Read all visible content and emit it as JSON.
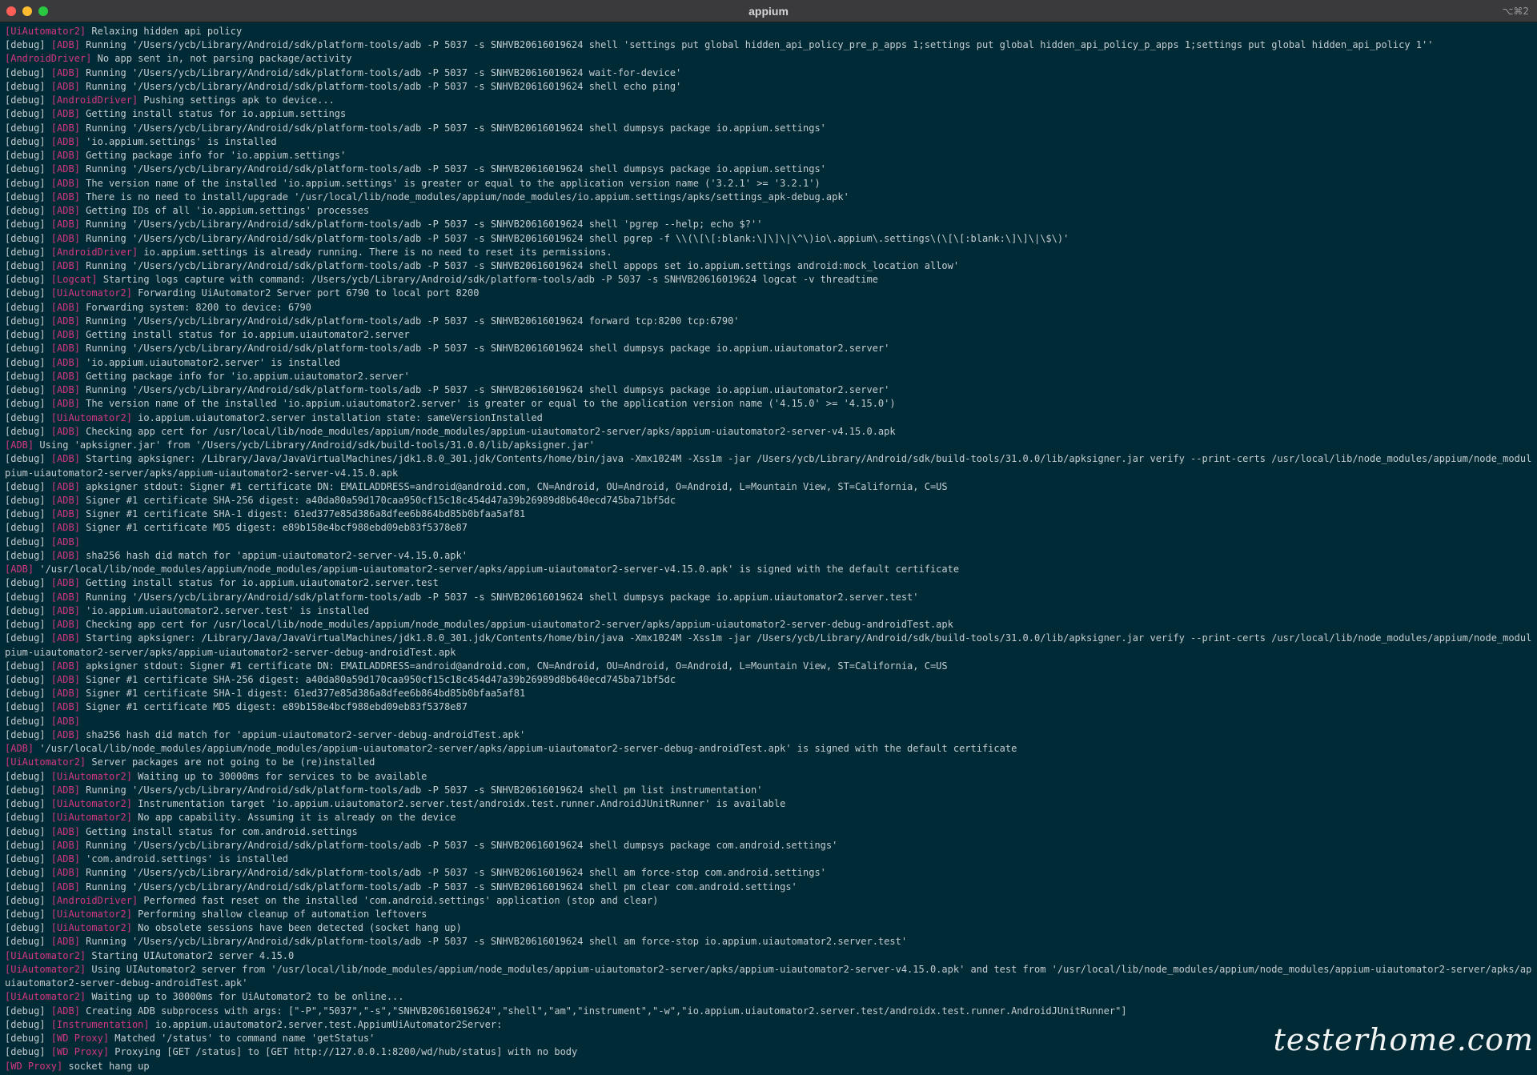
{
  "window": {
    "title": "appium",
    "shortcut": "⌥⌘2",
    "traffic_lights": [
      "close",
      "minimize",
      "zoom"
    ]
  },
  "colors": {
    "background": "#002b36",
    "titlebar": "#3a3a3c",
    "text": "#c5ccd0",
    "tag": "#d33682"
  },
  "watermark": "testerhome.com",
  "log_lines": [
    {
      "level": "",
      "tag": "[UiAutomator2]",
      "text": " Relaxing hidden api policy"
    },
    {
      "level": "[debug] ",
      "tag": "[ADB]",
      "text": " Running '/Users/ycb/Library/Android/sdk/platform-tools/adb -P 5037 -s SNHVB20616019624 shell 'settings put global hidden_api_policy_pre_p_apps 1;settings put global hidden_api_policy_p_apps 1;settings put global hidden_api_policy 1''"
    },
    {
      "level": "",
      "tag": "[AndroidDriver]",
      "text": " No app sent in, not parsing package/activity"
    },
    {
      "level": "[debug] ",
      "tag": "[ADB]",
      "text": " Running '/Users/ycb/Library/Android/sdk/platform-tools/adb -P 5037 -s SNHVB20616019624 wait-for-device'"
    },
    {
      "level": "[debug] ",
      "tag": "[ADB]",
      "text": " Running '/Users/ycb/Library/Android/sdk/platform-tools/adb -P 5037 -s SNHVB20616019624 shell echo ping'"
    },
    {
      "level": "[debug] ",
      "tag": "[AndroidDriver]",
      "text": " Pushing settings apk to device..."
    },
    {
      "level": "[debug] ",
      "tag": "[ADB]",
      "text": " Getting install status for io.appium.settings"
    },
    {
      "level": "[debug] ",
      "tag": "[ADB]",
      "text": " Running '/Users/ycb/Library/Android/sdk/platform-tools/adb -P 5037 -s SNHVB20616019624 shell dumpsys package io.appium.settings'"
    },
    {
      "level": "[debug] ",
      "tag": "[ADB]",
      "text": " 'io.appium.settings' is installed"
    },
    {
      "level": "[debug] ",
      "tag": "[ADB]",
      "text": " Getting package info for 'io.appium.settings'"
    },
    {
      "level": "[debug] ",
      "tag": "[ADB]",
      "text": " Running '/Users/ycb/Library/Android/sdk/platform-tools/adb -P 5037 -s SNHVB20616019624 shell dumpsys package io.appium.settings'"
    },
    {
      "level": "[debug] ",
      "tag": "[ADB]",
      "text": " The version name of the installed 'io.appium.settings' is greater or equal to the application version name ('3.2.1' >= '3.2.1')"
    },
    {
      "level": "[debug] ",
      "tag": "[ADB]",
      "text": " There is no need to install/upgrade '/usr/local/lib/node_modules/appium/node_modules/io.appium.settings/apks/settings_apk-debug.apk'"
    },
    {
      "level": "[debug] ",
      "tag": "[ADB]",
      "text": " Getting IDs of all 'io.appium.settings' processes"
    },
    {
      "level": "[debug] ",
      "tag": "[ADB]",
      "text": " Running '/Users/ycb/Library/Android/sdk/platform-tools/adb -P 5037 -s SNHVB20616019624 shell 'pgrep --help; echo $?''"
    },
    {
      "level": "[debug] ",
      "tag": "[ADB]",
      "text": " Running '/Users/ycb/Library/Android/sdk/platform-tools/adb -P 5037 -s SNHVB20616019624 shell pgrep -f \\\\(\\[\\[:blank:\\]\\]\\|\\^\\)io\\.appium\\.settings\\(\\[\\[:blank:\\]\\]\\|\\$\\)'"
    },
    {
      "level": "[debug] ",
      "tag": "[AndroidDriver]",
      "text": " io.appium.settings is already running. There is no need to reset its permissions."
    },
    {
      "level": "[debug] ",
      "tag": "[ADB]",
      "text": " Running '/Users/ycb/Library/Android/sdk/platform-tools/adb -P 5037 -s SNHVB20616019624 shell appops set io.appium.settings android:mock_location allow'"
    },
    {
      "level": "[debug] ",
      "tag": "[Logcat]",
      "text": " Starting logs capture with command: /Users/ycb/Library/Android/sdk/platform-tools/adb -P 5037 -s SNHVB20616019624 logcat -v threadtime"
    },
    {
      "level": "[debug] ",
      "tag": "[UiAutomator2]",
      "text": " Forwarding UiAutomator2 Server port 6790 to local port 8200"
    },
    {
      "level": "[debug] ",
      "tag": "[ADB]",
      "text": " Forwarding system: 8200 to device: 6790"
    },
    {
      "level": "[debug] ",
      "tag": "[ADB]",
      "text": " Running '/Users/ycb/Library/Android/sdk/platform-tools/adb -P 5037 -s SNHVB20616019624 forward tcp:8200 tcp:6790'"
    },
    {
      "level": "[debug] ",
      "tag": "[ADB]",
      "text": " Getting install status for io.appium.uiautomator2.server"
    },
    {
      "level": "[debug] ",
      "tag": "[ADB]",
      "text": " Running '/Users/ycb/Library/Android/sdk/platform-tools/adb -P 5037 -s SNHVB20616019624 shell dumpsys package io.appium.uiautomator2.server'"
    },
    {
      "level": "[debug] ",
      "tag": "[ADB]",
      "text": " 'io.appium.uiautomator2.server' is installed"
    },
    {
      "level": "[debug] ",
      "tag": "[ADB]",
      "text": " Getting package info for 'io.appium.uiautomator2.server'"
    },
    {
      "level": "[debug] ",
      "tag": "[ADB]",
      "text": " Running '/Users/ycb/Library/Android/sdk/platform-tools/adb -P 5037 -s SNHVB20616019624 shell dumpsys package io.appium.uiautomator2.server'"
    },
    {
      "level": "[debug] ",
      "tag": "[ADB]",
      "text": " The version name of the installed 'io.appium.uiautomator2.server' is greater or equal to the application version name ('4.15.0' >= '4.15.0')"
    },
    {
      "level": "[debug] ",
      "tag": "[UiAutomator2]",
      "text": " io.appium.uiautomator2.server installation state: sameVersionInstalled"
    },
    {
      "level": "[debug] ",
      "tag": "[ADB]",
      "text": " Checking app cert for /usr/local/lib/node_modules/appium/node_modules/appium-uiautomator2-server/apks/appium-uiautomator2-server-v4.15.0.apk"
    },
    {
      "level": "",
      "tag": "[ADB]",
      "text": " Using 'apksigner.jar' from '/Users/ycb/Library/Android/sdk/build-tools/31.0.0/lib/apksigner.jar'"
    },
    {
      "level": "[debug] ",
      "tag": "[ADB]",
      "text": " Starting apksigner: /Library/Java/JavaVirtualMachines/jdk1.8.0_301.jdk/Contents/home/bin/java -Xmx1024M -Xss1m -jar /Users/ycb/Library/Android/sdk/build-tools/31.0.0/lib/apksigner.jar verify --print-certs /usr/local/lib/node_modules/appium/node_modules/ap"
    },
    {
      "level": "",
      "tag": "",
      "text": "pium-uiautomator2-server/apks/appium-uiautomator2-server-v4.15.0.apk"
    },
    {
      "level": "[debug] ",
      "tag": "[ADB]",
      "text": " apksigner stdout: Signer #1 certificate DN: EMAILADDRESS=android@android.com, CN=Android, OU=Android, O=Android, L=Mountain View, ST=California, C=US"
    },
    {
      "level": "[debug] ",
      "tag": "[ADB]",
      "text": " Signer #1 certificate SHA-256 digest: a40da80a59d170caa950cf15c18c454d47a39b26989d8b640ecd745ba71bf5dc"
    },
    {
      "level": "[debug] ",
      "tag": "[ADB]",
      "text": " Signer #1 certificate SHA-1 digest: 61ed377e85d386a8dfee6b864bd85b0bfaa5af81"
    },
    {
      "level": "[debug] ",
      "tag": "[ADB]",
      "text": " Signer #1 certificate MD5 digest: e89b158e4bcf988ebd09eb83f5378e87"
    },
    {
      "level": "[debug] ",
      "tag": "[ADB]",
      "text": ""
    },
    {
      "level": "[debug] ",
      "tag": "[ADB]",
      "text": " sha256 hash did match for 'appium-uiautomator2-server-v4.15.0.apk'"
    },
    {
      "level": "",
      "tag": "[ADB]",
      "text": " '/usr/local/lib/node_modules/appium/node_modules/appium-uiautomator2-server/apks/appium-uiautomator2-server-v4.15.0.apk' is signed with the default certificate"
    },
    {
      "level": "[debug] ",
      "tag": "[ADB]",
      "text": " Getting install status for io.appium.uiautomator2.server.test"
    },
    {
      "level": "[debug] ",
      "tag": "[ADB]",
      "text": " Running '/Users/ycb/Library/Android/sdk/platform-tools/adb -P 5037 -s SNHVB20616019624 shell dumpsys package io.appium.uiautomator2.server.test'"
    },
    {
      "level": "[debug] ",
      "tag": "[ADB]",
      "text": " 'io.appium.uiautomator2.server.test' is installed"
    },
    {
      "level": "[debug] ",
      "tag": "[ADB]",
      "text": " Checking app cert for /usr/local/lib/node_modules/appium/node_modules/appium-uiautomator2-server/apks/appium-uiautomator2-server-debug-androidTest.apk"
    },
    {
      "level": "[debug] ",
      "tag": "[ADB]",
      "text": " Starting apksigner: /Library/Java/JavaVirtualMachines/jdk1.8.0_301.jdk/Contents/home/bin/java -Xmx1024M -Xss1m -jar /Users/ycb/Library/Android/sdk/build-tools/31.0.0/lib/apksigner.jar verify --print-certs /usr/local/lib/node_modules/appium/node_modules/ap"
    },
    {
      "level": "",
      "tag": "",
      "text": "pium-uiautomator2-server/apks/appium-uiautomator2-server-debug-androidTest.apk"
    },
    {
      "level": "[debug] ",
      "tag": "[ADB]",
      "text": " apksigner stdout: Signer #1 certificate DN: EMAILADDRESS=android@android.com, CN=Android, OU=Android, O=Android, L=Mountain View, ST=California, C=US"
    },
    {
      "level": "[debug] ",
      "tag": "[ADB]",
      "text": " Signer #1 certificate SHA-256 digest: a40da80a59d170caa950cf15c18c454d47a39b26989d8b640ecd745ba71bf5dc"
    },
    {
      "level": "[debug] ",
      "tag": "[ADB]",
      "text": " Signer #1 certificate SHA-1 digest: 61ed377e85d386a8dfee6b864bd85b0bfaa5af81"
    },
    {
      "level": "[debug] ",
      "tag": "[ADB]",
      "text": " Signer #1 certificate MD5 digest: e89b158e4bcf988ebd09eb83f5378e87"
    },
    {
      "level": "[debug] ",
      "tag": "[ADB]",
      "text": ""
    },
    {
      "level": "[debug] ",
      "tag": "[ADB]",
      "text": " sha256 hash did match for 'appium-uiautomator2-server-debug-androidTest.apk'"
    },
    {
      "level": "",
      "tag": "[ADB]",
      "text": " '/usr/local/lib/node_modules/appium/node_modules/appium-uiautomator2-server/apks/appium-uiautomator2-server-debug-androidTest.apk' is signed with the default certificate"
    },
    {
      "level": "",
      "tag": "[UiAutomator2]",
      "text": " Server packages are not going to be (re)installed"
    },
    {
      "level": "[debug] ",
      "tag": "[UiAutomator2]",
      "text": " Waiting up to 30000ms for services to be available"
    },
    {
      "level": "[debug] ",
      "tag": "[ADB]",
      "text": " Running '/Users/ycb/Library/Android/sdk/platform-tools/adb -P 5037 -s SNHVB20616019624 shell pm list instrumentation'"
    },
    {
      "level": "[debug] ",
      "tag": "[UiAutomator2]",
      "text": " Instrumentation target 'io.appium.uiautomator2.server.test/androidx.test.runner.AndroidJUnitRunner' is available"
    },
    {
      "level": "[debug] ",
      "tag": "[UiAutomator2]",
      "text": " No app capability. Assuming it is already on the device"
    },
    {
      "level": "[debug] ",
      "tag": "[ADB]",
      "text": " Getting install status for com.android.settings"
    },
    {
      "level": "[debug] ",
      "tag": "[ADB]",
      "text": " Running '/Users/ycb/Library/Android/sdk/platform-tools/adb -P 5037 -s SNHVB20616019624 shell dumpsys package com.android.settings'"
    },
    {
      "level": "[debug] ",
      "tag": "[ADB]",
      "text": " 'com.android.settings' is installed"
    },
    {
      "level": "[debug] ",
      "tag": "[ADB]",
      "text": " Running '/Users/ycb/Library/Android/sdk/platform-tools/adb -P 5037 -s SNHVB20616019624 shell am force-stop com.android.settings'"
    },
    {
      "level": "[debug] ",
      "tag": "[ADB]",
      "text": " Running '/Users/ycb/Library/Android/sdk/platform-tools/adb -P 5037 -s SNHVB20616019624 shell pm clear com.android.settings'"
    },
    {
      "level": "[debug] ",
      "tag": "[AndroidDriver]",
      "text": " Performed fast reset on the installed 'com.android.settings' application (stop and clear)"
    },
    {
      "level": "[debug] ",
      "tag": "[UiAutomator2]",
      "text": " Performing shallow cleanup of automation leftovers"
    },
    {
      "level": "[debug] ",
      "tag": "[UiAutomator2]",
      "text": " No obsolete sessions have been detected (socket hang up)"
    },
    {
      "level": "[debug] ",
      "tag": "[ADB]",
      "text": " Running '/Users/ycb/Library/Android/sdk/platform-tools/adb -P 5037 -s SNHVB20616019624 shell am force-stop io.appium.uiautomator2.server.test'"
    },
    {
      "level": "",
      "tag": "[UiAutomator2]",
      "text": " Starting UIAutomator2 server 4.15.0"
    },
    {
      "level": "",
      "tag": "[UiAutomator2]",
      "text": " Using UIAutomator2 server from '/usr/local/lib/node_modules/appium/node_modules/appium-uiautomator2-server/apks/appium-uiautomator2-server-v4.15.0.apk' and test from '/usr/local/lib/node_modules/appium/node_modules/appium-uiautomator2-server/apks/appium-"
    },
    {
      "level": "",
      "tag": "",
      "text": "uiautomator2-server-debug-androidTest.apk'"
    },
    {
      "level": "",
      "tag": "[UiAutomator2]",
      "text": " Waiting up to 30000ms for UiAutomator2 to be online..."
    },
    {
      "level": "[debug] ",
      "tag": "[ADB]",
      "text": " Creating ADB subprocess with args: [\"-P\",\"5037\",\"-s\",\"SNHVB20616019624\",\"shell\",\"am\",\"instrument\",\"-w\",\"io.appium.uiautomator2.server.test/androidx.test.runner.AndroidJUnitRunner\"]"
    },
    {
      "level": "[debug] ",
      "tag": "[Instrumentation]",
      "text": " io.appium.uiautomator2.server.test.AppiumUiAutomator2Server:"
    },
    {
      "level": "[debug] ",
      "tag": "[WD Proxy]",
      "text": " Matched '/status' to command name 'getStatus'"
    },
    {
      "level": "[debug] ",
      "tag": "[WD Proxy]",
      "text": " Proxying [GET /status] to [GET http://127.0.0.1:8200/wd/hub/status] with no body"
    },
    {
      "level": "",
      "tag": "[WD Proxy]",
      "text": " socket hang up"
    }
  ]
}
